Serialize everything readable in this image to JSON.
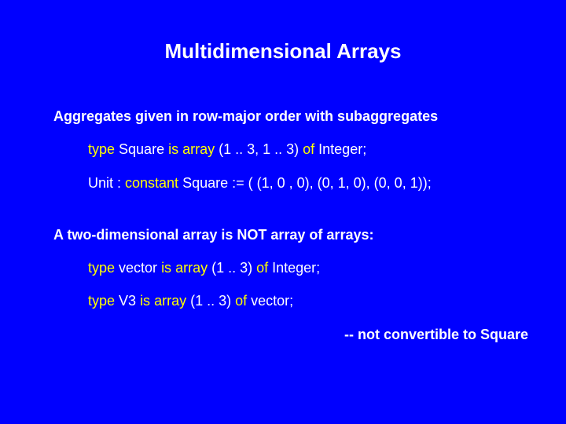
{
  "title": "Multidimensional Arrays",
  "l1": "Aggregates given in row-major order with subaggregates",
  "l2": {
    "kw1": "type",
    "t1": " Square ",
    "kw2": "is",
    "kw3": " array",
    "t2": " (1 .. 3, 1 .. 3) ",
    "kw4": "of",
    "t3": " Integer;"
  },
  "l3": {
    "t1": "Unit : ",
    "kw1": "constant",
    "t2": " Square := ( (1, 0 , 0), (0, 1, 0), (0, 0, 1));"
  },
  "l4": "A two-dimensional array is NOT array of arrays:",
  "l5": {
    "kw1": "type",
    "t1": " vector ",
    "kw2": "is",
    "kw3": " array",
    "t2": " (1 .. 3) ",
    "kw4": "of",
    "t3": " Integer;"
  },
  "l6": {
    "kw1": "type",
    "t1": "  V3 ",
    "kw2": "is",
    "kw3": " array",
    "t2": " (1 .. 3) ",
    "kw4": "of",
    "t3": " vector;"
  },
  "l7": "-- not convertible to Square"
}
